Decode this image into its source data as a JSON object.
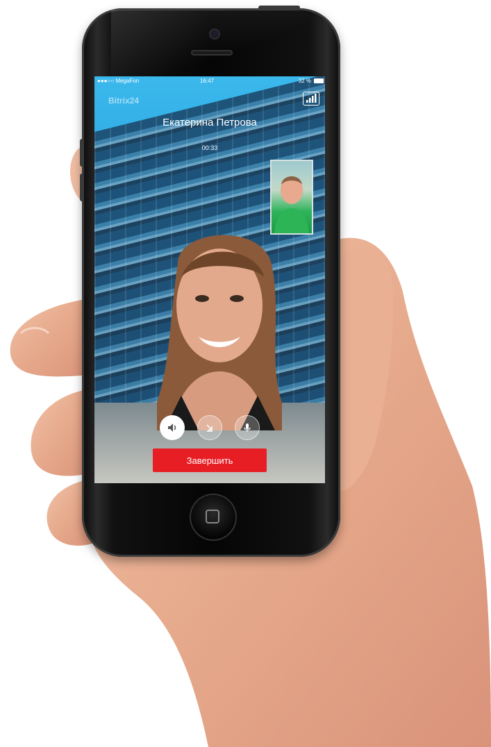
{
  "status_bar": {
    "carrier": "●●●○○ MegaFon",
    "time": "16:47",
    "battery": "32 %"
  },
  "app": {
    "brand": "Bitrix24"
  },
  "call": {
    "caller_name": "Екатерина  Петрова",
    "duration": "00:33",
    "end_label": "Завершить"
  },
  "controls": [
    {
      "icon": "speaker-icon",
      "active": true
    },
    {
      "icon": "minimize-icon",
      "active": false
    },
    {
      "icon": "microphone-icon",
      "active": false
    }
  ],
  "colors": {
    "end_button": "#e81e25",
    "sky": "#3bb8ec"
  }
}
